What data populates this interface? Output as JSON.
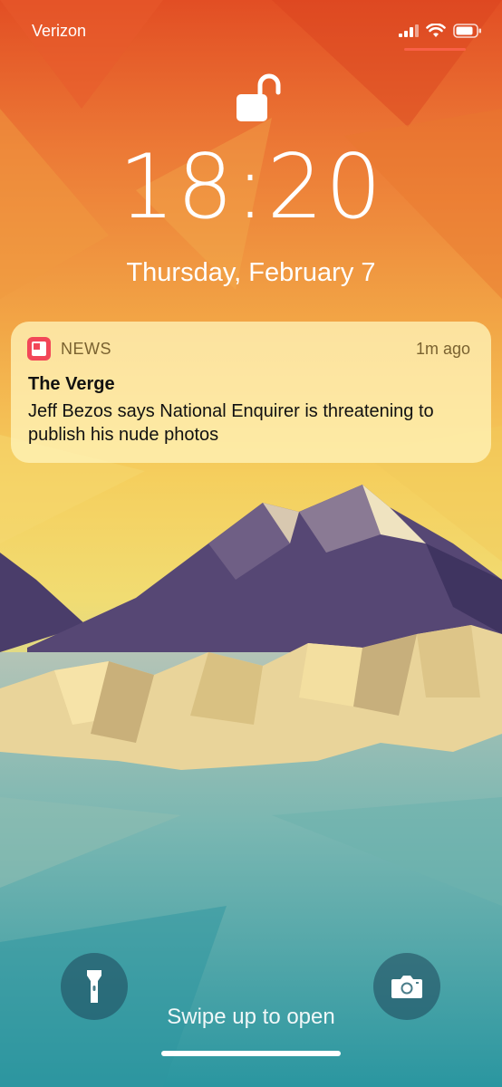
{
  "status_bar": {
    "carrier": "Verizon",
    "signal_icon": "cellular-signal-icon",
    "wifi_icon": "wifi-icon",
    "battery_icon": "battery-icon"
  },
  "lock_screen": {
    "lock_icon": "unlocked-padlock-icon",
    "time": "18:20",
    "date": "Thursday, February 7"
  },
  "notification": {
    "app_name": "NEWS",
    "app_icon": "news-app-icon",
    "time_ago": "1m ago",
    "title": "The Verge",
    "body": "Jeff Bezos says National Enquirer is threatening to publish his nude photos"
  },
  "bottom": {
    "flashlight_icon": "flashlight-icon",
    "camera_icon": "camera-icon",
    "swipe_text": "Swipe up to open"
  },
  "colors": {
    "wallpaper_top": "#e4572a",
    "wallpaper_mid": "#f2cf5b",
    "wallpaper_bottom": "#3a9aa0",
    "news_app": "#f24658",
    "notification_bg": "#fff4b9"
  }
}
